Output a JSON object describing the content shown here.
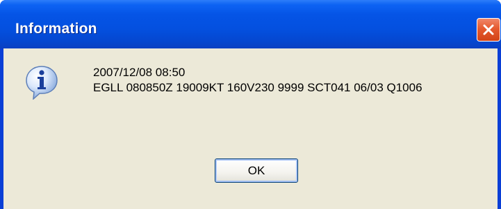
{
  "dialog": {
    "title": "Information",
    "icon": "info-icon",
    "close_icon": "close-icon",
    "message_lines": [
      "2007/12/08 08:50",
      "EGLL 080850Z 19009KT 160V230 9999 SCT041 06/03 Q1006"
    ],
    "ok_label": "OK"
  },
  "colors": {
    "titlebar": "#0554e6",
    "client_bg": "#ece9d8",
    "close_button": "#e55a2f",
    "title_text": "#ffffff"
  }
}
